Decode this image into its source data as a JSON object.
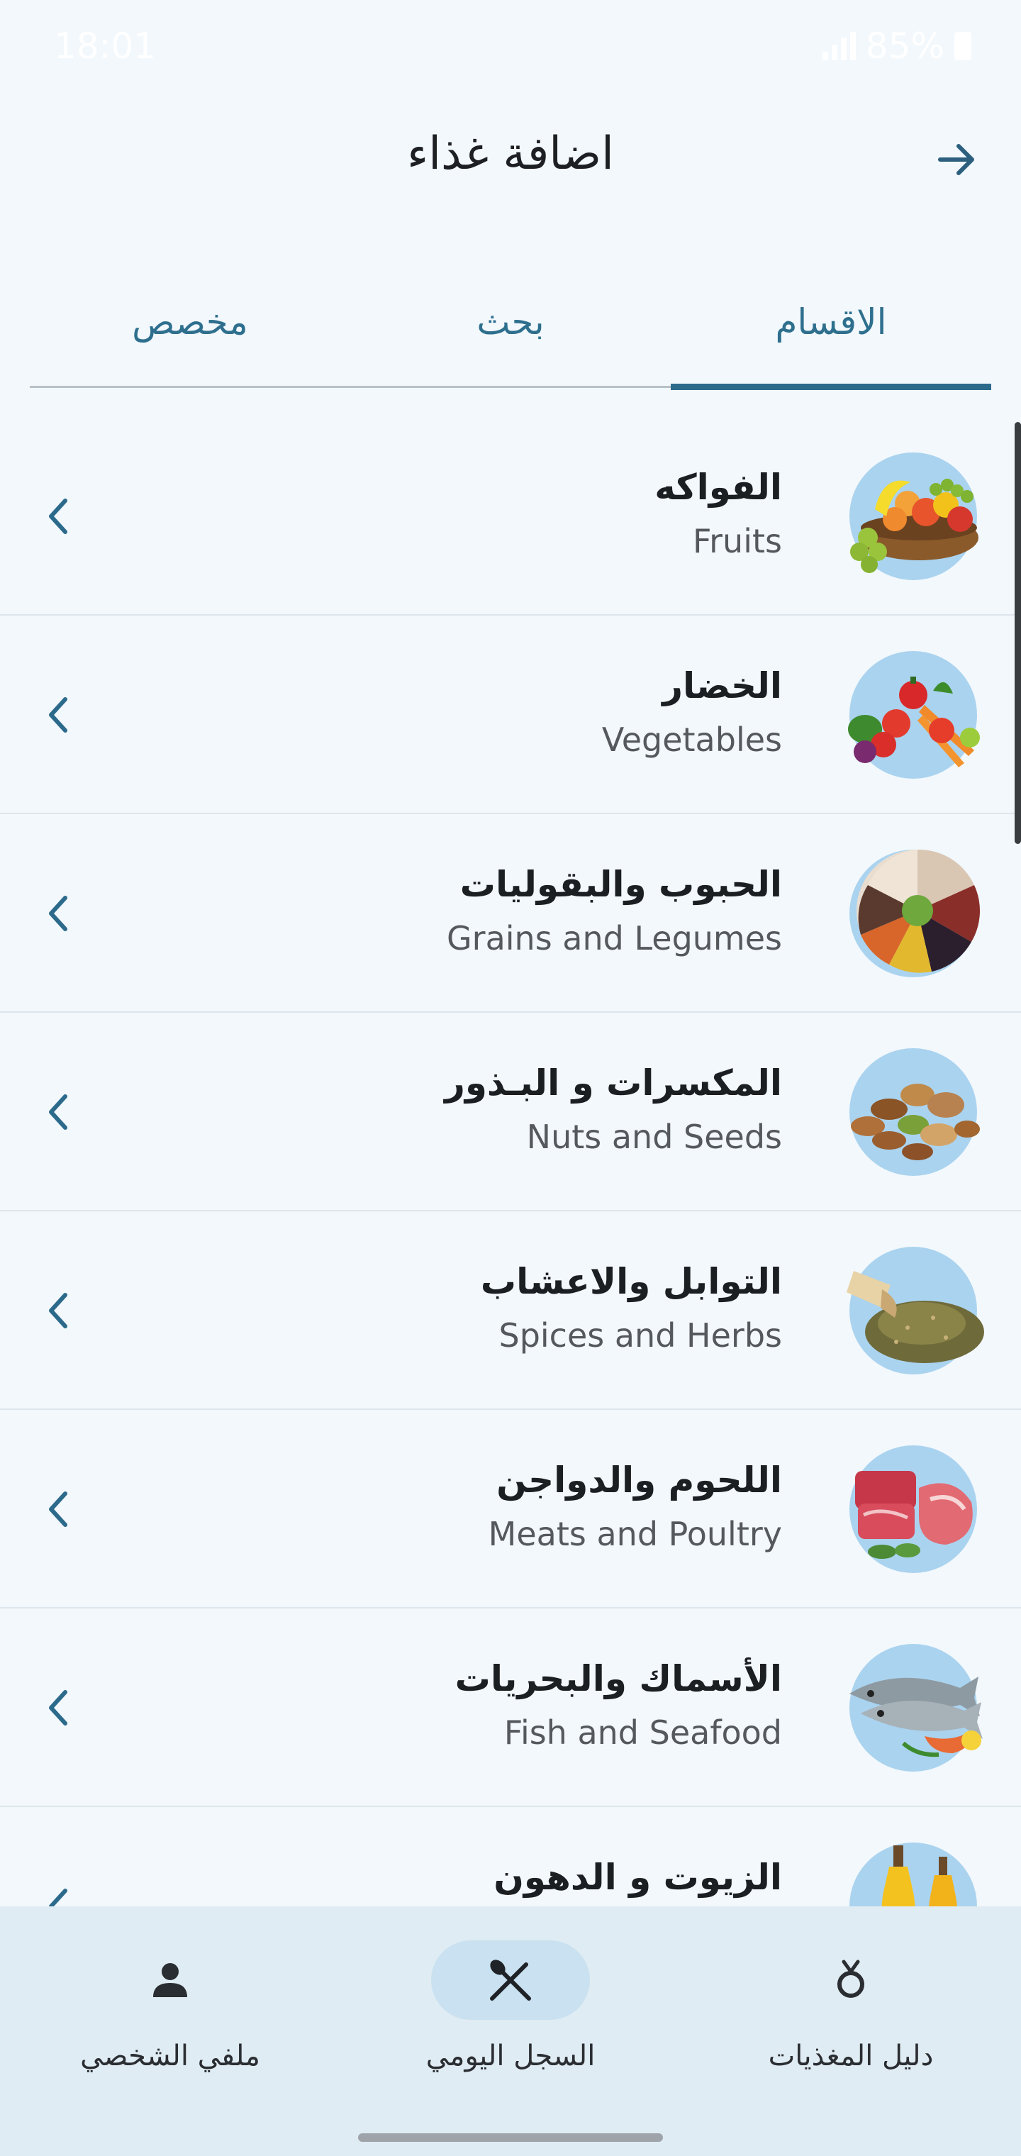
{
  "status_bar": {
    "time": "18:01",
    "battery": "85%"
  },
  "header": {
    "title": "اضافة غذاء",
    "back_icon": "arrow-right-icon"
  },
  "tabs": [
    {
      "label": "الاقسام",
      "active": true
    },
    {
      "label": "بحث",
      "active": false
    },
    {
      "label": "مخصص",
      "active": false
    }
  ],
  "categories": [
    {
      "name_ar": "الفواكه",
      "name_en": "Fruits",
      "icon": "fruits-image"
    },
    {
      "name_ar": "الخضار",
      "name_en": "Vegetables",
      "icon": "vegetables-image"
    },
    {
      "name_ar": "الحبوب والبقوليات",
      "name_en": "Grains and Legumes",
      "icon": "grains-legumes-image"
    },
    {
      "name_ar": "المكسرات و البـذور",
      "name_en": "Nuts and Seeds",
      "icon": "nuts-seeds-image"
    },
    {
      "name_ar": "التوابل والاعشاب",
      "name_en": "Spices and Herbs",
      "icon": "spices-herbs-image"
    },
    {
      "name_ar": "اللحوم والدواجن",
      "name_en": "Meats and Poultry",
      "icon": "meats-poultry-image"
    },
    {
      "name_ar": "الأسماك والبحريات",
      "name_en": "Fish and Seafood",
      "icon": "fish-seafood-image"
    },
    {
      "name_ar": "الزيوت و الدهون",
      "name_en": "",
      "icon": "oils-fats-image"
    }
  ],
  "bottom_nav": [
    {
      "label": "ملفي الشخصي",
      "icon": "person-icon",
      "active": false
    },
    {
      "label": "السجل اليومي",
      "icon": "utensils-icon",
      "active": true
    },
    {
      "label": "دليل المغذيات",
      "icon": "nutrient-guide-icon",
      "active": false
    }
  ],
  "colors": {
    "accent": "#2c6a8c",
    "background": "#f2f8fc",
    "nav_background": "#e0ecf3",
    "image_circle": "#aad3ef"
  }
}
